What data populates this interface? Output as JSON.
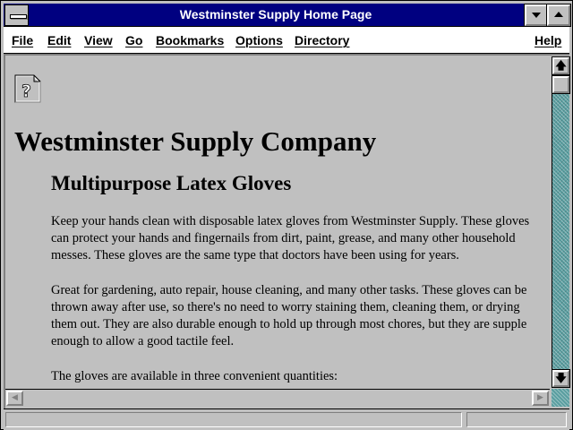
{
  "window": {
    "title": "Westminster Supply Home Page"
  },
  "menu": {
    "items": [
      "File",
      "Edit",
      "View",
      "Go",
      "Bookmarks",
      "Options",
      "Directory"
    ],
    "help": "Help"
  },
  "page": {
    "icon": "broken-image-icon",
    "icon_glyph": "?",
    "company_title": "Westminster Supply Company",
    "product_title": "Multipurpose Latex Gloves",
    "paragraphs": [
      "Keep your hands clean with disposable latex gloves from Westminster Supply. These gloves can protect your hands and fingernails from dirt, paint, grease, and many other household messes. These gloves are the same type that doctors have been using for years.",
      "Great for gardening, auto repair, house cleaning, and many other tasks. These gloves can be thrown away after use, so there's no need to worry staining them, cleaning them, or drying them out. They are also durable enough to hold up through most chores, but they are supple enough to allow a good tactile feel.",
      "The gloves are available in three convenient quantities:"
    ]
  },
  "scrollbars": {
    "up_arrow": "up-arrow-icon",
    "down_arrow": "down-arrow-icon",
    "left_arrow": "left-arrow-icon",
    "right_arrow": "right-arrow-icon",
    "up_glyph": "🡅",
    "down_glyph": "🡇",
    "left_glyph": "◀",
    "right_glyph": "▶"
  },
  "status": {
    "text": ""
  },
  "colors": {
    "title_bar": "#000080",
    "chrome": "#c0c0c0",
    "scroll_track": "#5a9ea0"
  }
}
